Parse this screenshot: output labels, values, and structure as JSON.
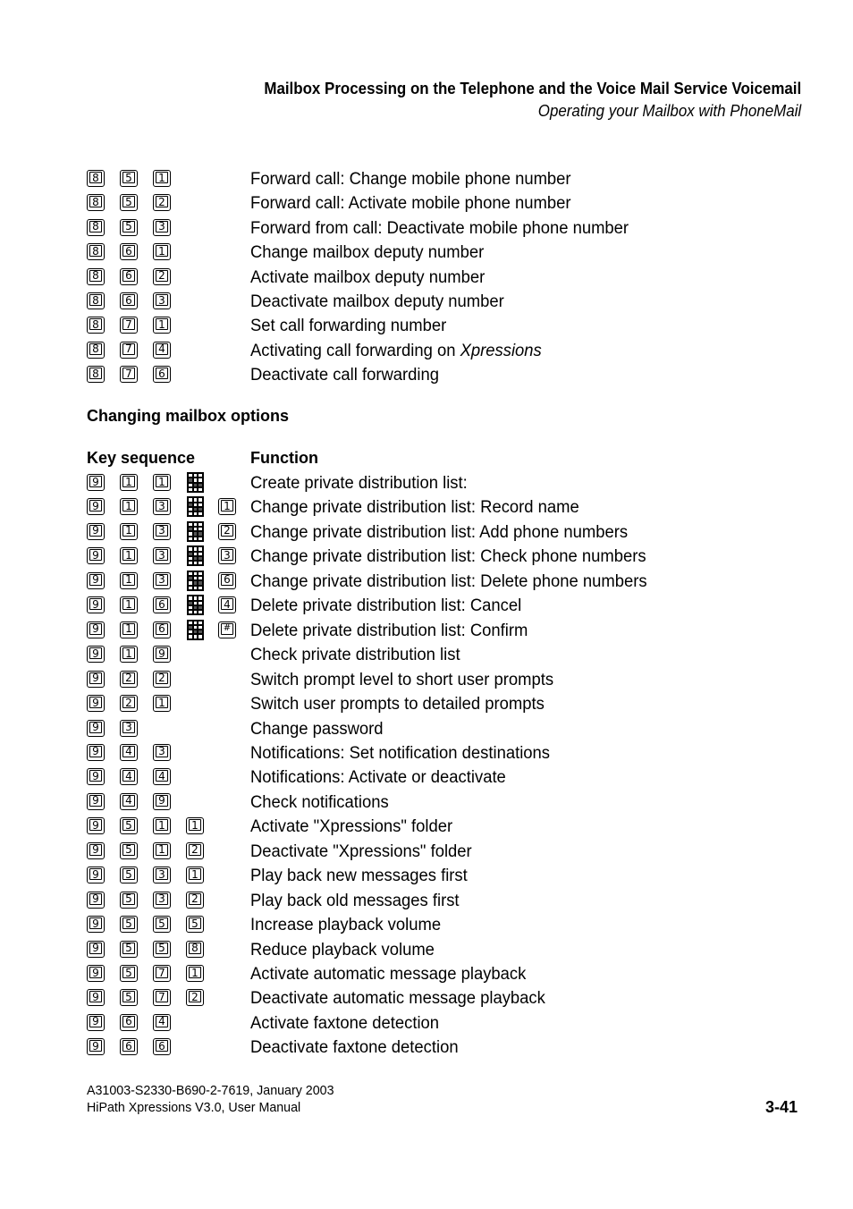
{
  "header": {
    "title": "Mailbox Processing on the Telephone and the Voice Mail Service Voicemail",
    "subtitle": "Operating your Mailbox with PhoneMail"
  },
  "forwarding_table": {
    "rows": [
      {
        "keys": [
          "8",
          "5",
          "1"
        ],
        "function": "Forward call: Change mobile phone number"
      },
      {
        "keys": [
          "8",
          "5",
          "2"
        ],
        "function": "Forward call: Activate mobile phone number"
      },
      {
        "keys": [
          "8",
          "5",
          "3"
        ],
        "function": "Forward from call: Deactivate mobile phone number"
      },
      {
        "keys": [
          "8",
          "6",
          "1"
        ],
        "function": "Change mailbox deputy number"
      },
      {
        "keys": [
          "8",
          "6",
          "2"
        ],
        "function": "Activate mailbox deputy number"
      },
      {
        "keys": [
          "8",
          "6",
          "3"
        ],
        "function": "Deactivate mailbox deputy number"
      },
      {
        "keys": [
          "8",
          "7",
          "1"
        ],
        "function": "Set call forwarding number"
      },
      {
        "keys": [
          "8",
          "7",
          "4"
        ],
        "function": "Activating call forwarding on ",
        "function_italic": "Xpressions"
      },
      {
        "keys": [
          "8",
          "7",
          "6"
        ],
        "function": "Deactivate call forwarding"
      }
    ]
  },
  "options_section": {
    "heading": "Changing mailbox options",
    "col_key_sequence": "Key sequence",
    "col_function": "Function",
    "rows": [
      {
        "keys": [
          "9",
          "1",
          "1",
          "keypad"
        ],
        "function": "Create private distribution list:"
      },
      {
        "keys": [
          "9",
          "1",
          "3",
          "keypad",
          "1"
        ],
        "function": "Change private distribution list: Record name"
      },
      {
        "keys": [
          "9",
          "1",
          "3",
          "keypad",
          "2"
        ],
        "function": "Change private distribution list: Add phone numbers"
      },
      {
        "keys": [
          "9",
          "1",
          "3",
          "keypad",
          "3"
        ],
        "function": "Change private distribution list: Check phone numbers"
      },
      {
        "keys": [
          "9",
          "1",
          "3",
          "keypad",
          "6"
        ],
        "function": "Change private distribution list: Delete phone numbers"
      },
      {
        "keys": [
          "9",
          "1",
          "6",
          "keypad",
          "4"
        ],
        "function": "Delete private distribution list: Cancel"
      },
      {
        "keys": [
          "9",
          "1",
          "6",
          "keypad",
          "#"
        ],
        "function": "Delete private distribution list: Confirm"
      },
      {
        "keys": [
          "9",
          "1",
          "9"
        ],
        "function": "Check private distribution list"
      },
      {
        "keys": [
          "9",
          "2",
          "2"
        ],
        "function": "Switch prompt level to short user prompts"
      },
      {
        "keys": [
          "9",
          "2",
          "1"
        ],
        "function": "Switch user prompts to detailed prompts"
      },
      {
        "keys": [
          "9",
          "3"
        ],
        "function": "Change password"
      },
      {
        "keys": [
          "9",
          "4",
          "3"
        ],
        "function": "Notifications: Set notification destinations"
      },
      {
        "keys": [
          "9",
          "4",
          "4"
        ],
        "function": "Notifications: Activate or deactivate"
      },
      {
        "keys": [
          "9",
          "4",
          "9"
        ],
        "function": "Check notifications"
      },
      {
        "keys": [
          "9",
          "5",
          "1",
          "1"
        ],
        "function": "Activate \"Xpressions\" folder"
      },
      {
        "keys": [
          "9",
          "5",
          "1",
          "2"
        ],
        "function": "Deactivate \"Xpressions\" folder"
      },
      {
        "keys": [
          "9",
          "5",
          "3",
          "1"
        ],
        "function": "Play back new messages first"
      },
      {
        "keys": [
          "9",
          "5",
          "3",
          "2"
        ],
        "function": "Play back old messages first"
      },
      {
        "keys": [
          "9",
          "5",
          "5",
          "5"
        ],
        "function": "Increase playback volume"
      },
      {
        "keys": [
          "9",
          "5",
          "5",
          "8"
        ],
        "function": "Reduce playback volume"
      },
      {
        "keys": [
          "9",
          "5",
          "7",
          "1"
        ],
        "function": "Activate automatic message playback"
      },
      {
        "keys": [
          "9",
          "5",
          "7",
          "2"
        ],
        "function": "Deactivate automatic message playback"
      },
      {
        "keys": [
          "9",
          "6",
          "4"
        ],
        "function": "Activate faxtone detection"
      },
      {
        "keys": [
          "9",
          "6",
          "6"
        ],
        "function": "Deactivate faxtone detection"
      }
    ]
  },
  "footer": {
    "doc_id": "A31003-S2330-B690-2-7619, January 2003",
    "product": "HiPath Xpressions V3.0, User Manual",
    "page_number": "3-41"
  }
}
